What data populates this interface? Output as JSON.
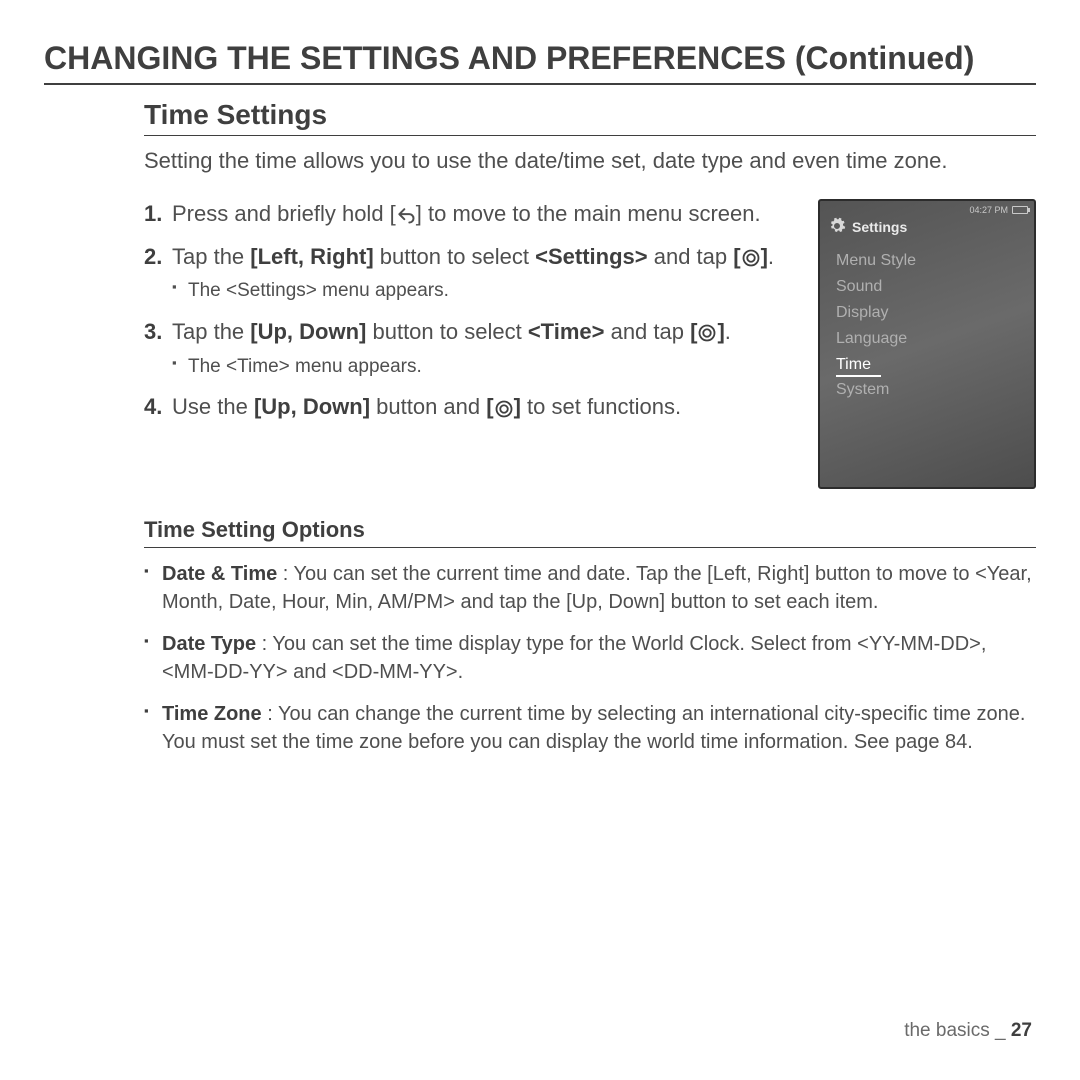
{
  "page_title": "CHANGING THE SETTINGS AND PREFERENCES (Continued)",
  "section_heading": "Time Settings",
  "intro": "Setting the time allows you to use the date/time set, date type and even time zone.",
  "steps": {
    "s1a": "Press and briefly hold [",
    "s1b": "] to move to the main menu screen.",
    "s2a": "Tap the ",
    "s2b": "[Left, Right]",
    "s2c": " button to select ",
    "s2d": "<Settings>",
    "s2e": " and tap ",
    "s2f": "[",
    "s2g": "]",
    "s2h": ".",
    "s2sub": "The <Settings> menu appears.",
    "s3a": "Tap the ",
    "s3b": "[Up, Down]",
    "s3c": " button to select ",
    "s3d": "<Time>",
    "s3e": " and tap ",
    "s3f": "[",
    "s3g": "]",
    "s3h": ".",
    "s3sub": "The <Time> menu appears.",
    "s4a": "Use the ",
    "s4b": "[Up, Down]",
    "s4c": " button and ",
    "s4d": "[",
    "s4e": "]",
    "s4f": " to set functions."
  },
  "device": {
    "time": "04:27 PM",
    "title": "Settings",
    "items": [
      "Menu Style",
      "Sound",
      "Display",
      "Language",
      "Time",
      "System"
    ],
    "selected_index": 4
  },
  "subsection_heading": "Time Setting Options",
  "options": {
    "o1_label": "Date & Time",
    "o1_text": " : You can set the current time and date. Tap the [Left, Right] button to move to <Year, Month, Date, Hour, Min, AM/PM> and tap the [Up, Down] button to set each item.",
    "o2_label": "Date Type",
    "o2_text": " : You can set the time display type for the World Clock. Select from <YY-MM-DD>, <MM-DD-YY> and <DD-MM-YY>.",
    "o3_label": "Time Zone",
    "o3_text": " : You can change the current time by selecting an international city-specific time zone. You must set the time zone before you can display the world time information. See page 84."
  },
  "footer_section": "the basics",
  "footer_sep": " _ ",
  "footer_page": "27"
}
